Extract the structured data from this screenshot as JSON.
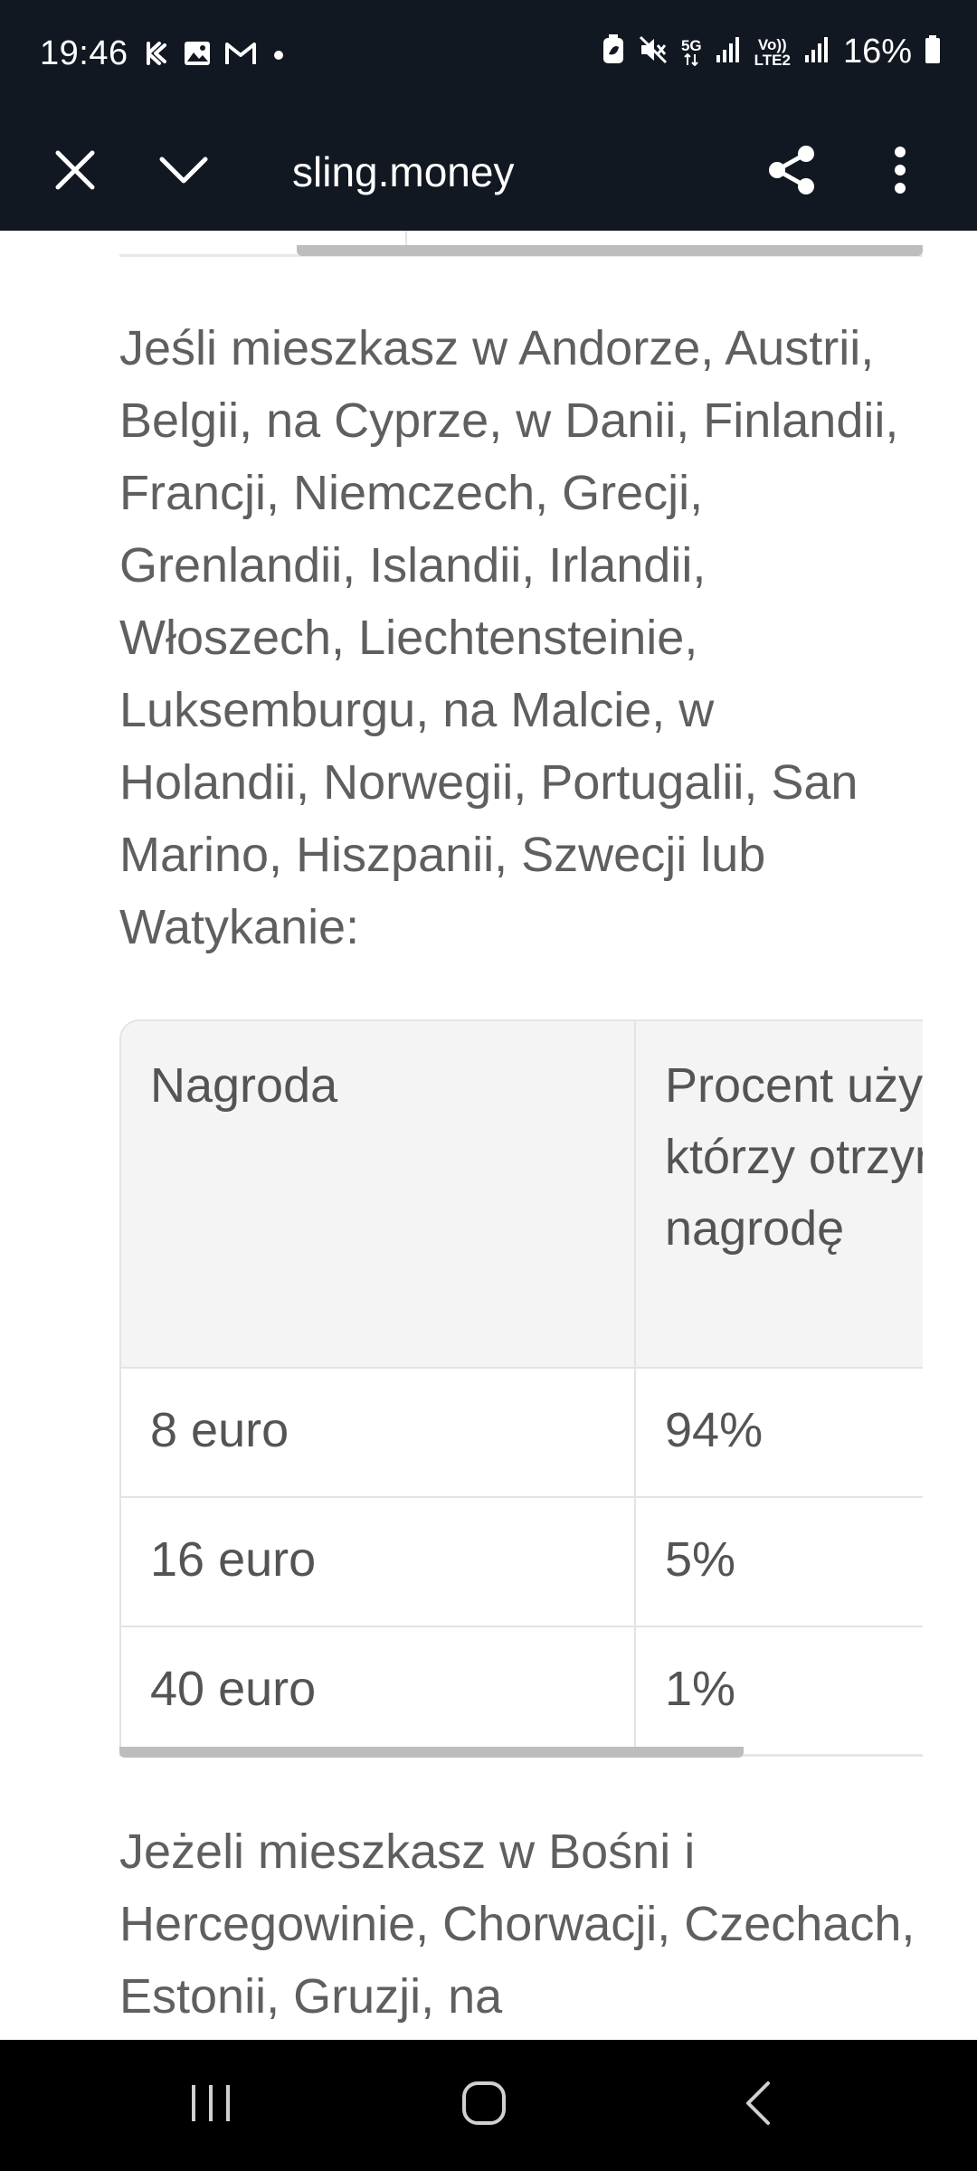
{
  "status_bar": {
    "time": "19:46",
    "network_5g": "5G",
    "network_volte": "Vo)) LTE2",
    "battery": "16%",
    "left_icons": [
      "kaspi-icon",
      "gallery-icon",
      "gmail-icon",
      "notification-dot-icon"
    ],
    "right_icons": [
      "eco-battery-icon",
      "mute-icon",
      "signal-icon",
      "signal-icon",
      "battery-icon"
    ]
  },
  "browser": {
    "url": "sling.money",
    "close_icon": "close-icon",
    "minimize_icon": "chevron-down-icon",
    "share_icon": "share-icon",
    "menu_icon": "more-vert-icon"
  },
  "content": {
    "paragraph1": "Jeśli mieszkasz w Andorze, Austrii, Belgii, na Cyprze, w Danii, Finlandii, Francji, Niemczech, Grecji, Grenlandii, Islandii, Irlandii, Włoszech, Liechtensteinie, Luksemburgu, na Malcie, w Holandii, Norwegii, Portugalii, San Marino, Hiszpanii, Szwecji lub Watykanie:",
    "table": {
      "headers": [
        "Nagroda",
        "Procent użytkowników, którzy otrzymują tę nagrodę"
      ],
      "rows": [
        [
          "8 euro",
          "94%"
        ],
        [
          "16 euro",
          "5%"
        ],
        [
          "40 euro",
          "1%"
        ]
      ]
    },
    "paragraph2": "Jeżeli mieszkasz w Bośni i Hercegowinie, Chorwacji, Czechach, Estonii, Gruzji, na"
  },
  "nav_bar": {
    "icons": [
      "recent-apps-icon",
      "home-icon",
      "back-icon"
    ]
  }
}
